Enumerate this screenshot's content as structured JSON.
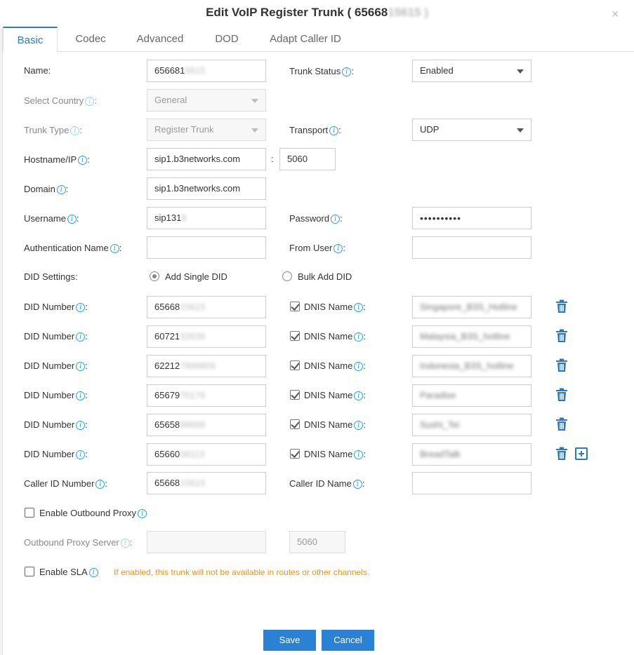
{
  "dialog": {
    "title_prefix": "Edit VoIP Register Trunk ( 65668",
    "title_blurred": "15615 )",
    "close_glyph": "×"
  },
  "tabs": [
    {
      "label": "Basic",
      "active": true
    },
    {
      "label": "Codec"
    },
    {
      "label": "Advanced"
    },
    {
      "label": "DOD"
    },
    {
      "label": "Adapt Caller ID"
    }
  ],
  "info_glyph": "i",
  "form": {
    "name": {
      "label": "Name:",
      "value_visible": "656681",
      "value_blurred": "5615"
    },
    "trunk_status": {
      "label": "Trunk Status",
      "value": "Enabled"
    },
    "select_country": {
      "label": "Select Country",
      "value": "General"
    },
    "trunk_type": {
      "label": "Trunk Type",
      "value": "Register Trunk"
    },
    "transport": {
      "label": "Transport",
      "value": "UDP"
    },
    "hostname": {
      "label": "Hostname/IP",
      "value": "sip1.b3networks.com",
      "port": "5060",
      "separator": ":"
    },
    "domain": {
      "label": "Domain",
      "value": "sip1.b3networks.com"
    },
    "username": {
      "label": "Username",
      "value_visible": "sip131",
      "value_blurred": "8"
    },
    "password": {
      "label": "Password",
      "value": "••••••••••"
    },
    "auth_name": {
      "label": "Authentication Name",
      "value": ""
    },
    "from_user": {
      "label": "From User",
      "value": ""
    },
    "did_settings": {
      "label": "DID Settings:",
      "option_single": "Add Single DID",
      "option_bulk": "Bulk Add DID"
    },
    "did_label": "DID Number",
    "dnis_label": "DNIS Name",
    "did_rows": [
      {
        "num_visible": "65668",
        "num_blurred": "15615",
        "dnis": "Singapore_B3S_Hotline"
      },
      {
        "num_visible": "60721",
        "num_blurred": "32639",
        "dnis": "Malaysia_B3S_hotline"
      },
      {
        "num_visible": "62212",
        "num_blurred": "7899809",
        "dnis": "Indonesia_B3S_hotline"
      },
      {
        "num_visible": "65679",
        "num_blurred": "70176",
        "dnis": "Paradise"
      },
      {
        "num_visible": "65658",
        "num_blurred": "88699",
        "dnis": "Sushi_Tei"
      },
      {
        "num_visible": "65660",
        "num_blurred": "08113",
        "dnis": "BreadTalk"
      }
    ],
    "caller_id_number": {
      "label": "Caller ID Number",
      "value_visible": "65668",
      "value_blurred": "15615"
    },
    "caller_id_name": {
      "label": "Caller ID Name",
      "value": ""
    },
    "outbound_proxy": {
      "label": "Enable Outbound Proxy",
      "checked": false
    },
    "outbound_proxy_server": {
      "label": "Outbound Proxy Server",
      "value": "",
      "port": "5060"
    },
    "enable_sla": {
      "label": "Enable SLA",
      "checked": false,
      "warning": "If enabled, this trunk will not be available in routes or other channels."
    }
  },
  "footer": {
    "save": "Save",
    "cancel": "Cancel"
  },
  "colors": {
    "accent": "#2b79c2",
    "button": "#2b82d4",
    "warning": "#e8961a",
    "info": "#2aa0d8"
  }
}
